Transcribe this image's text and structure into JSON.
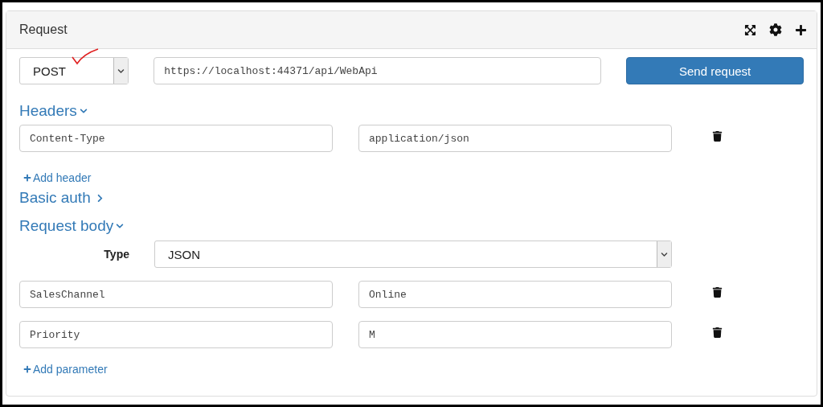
{
  "panel": {
    "title": "Request"
  },
  "method": {
    "value": "POST"
  },
  "url": {
    "value": "https://localhost:44371/api/WebApi"
  },
  "send_button": "Send request",
  "headers": {
    "title": "Headers",
    "expanded": true,
    "rows": [
      {
        "key": "Content-Type",
        "value": "application/json"
      }
    ],
    "add_link": "Add header"
  },
  "basic_auth": {
    "title": "Basic auth",
    "expanded": false
  },
  "request_body": {
    "title": "Request body",
    "expanded": true,
    "type_label": "Type",
    "type_value": "JSON",
    "parameters": [
      {
        "key": "SalesChannel",
        "value": "Online"
      },
      {
        "key": "Priority",
        "value": "M"
      }
    ],
    "add_link": "Add parameter"
  }
}
